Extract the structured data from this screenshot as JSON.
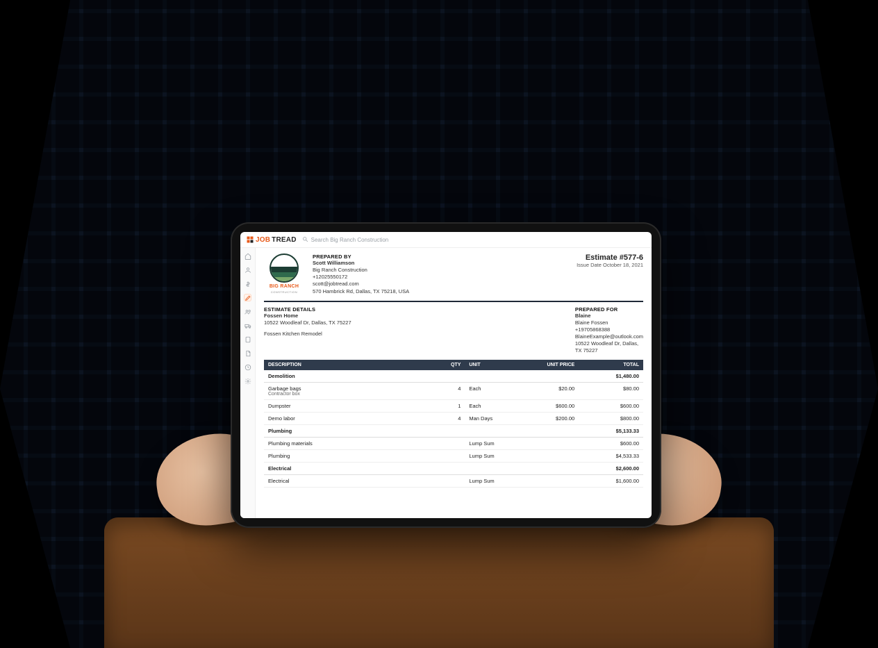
{
  "app": {
    "logo_job": "JOB",
    "logo_tread": "TREAD",
    "search_placeholder": "Search Big Ranch Construction"
  },
  "sidebar": {
    "items": [
      "home",
      "user",
      "dollar",
      "pencil",
      "people",
      "truck",
      "tablet",
      "document",
      "clock",
      "gear"
    ],
    "active_index": 3
  },
  "prepared_by": {
    "label": "PREPARED BY",
    "name": "Scott Williamson",
    "company": "Big Ranch Construction",
    "phone": "+12025550172",
    "email": "scott@jobtread.com",
    "address": "570 Hambrick Rd, Dallas, TX 75218, USA"
  },
  "company_logo": {
    "name": "BIG RANCH",
    "subtitle": "CONSTRUCTION"
  },
  "estimate": {
    "title": "Estimate #577-6",
    "issue_date": "Issue Date October 18, 2021"
  },
  "details": {
    "label": "ESTIMATE DETAILS",
    "project": "Fossen Home",
    "address": "10522 Woodleaf Dr, Dallas, TX 75227",
    "job": "Fossen Kitchen Remodel"
  },
  "prepared_for": {
    "label": "PREPARED FOR",
    "short_name": "Blaine",
    "full_name": "Blaine Fossen",
    "phone": "+19705868388",
    "email": "BlaineExample@outlook.com",
    "address1": "10522 Woodleaf Dr, Dallas,",
    "address2": "TX 75227"
  },
  "table": {
    "headers": {
      "description": "DESCRIPTION",
      "qty": "QTY",
      "unit": "UNIT",
      "unit_price": "UNIT PRICE",
      "total": "TOTAL"
    },
    "sections": [
      {
        "name": "Demolition",
        "total": "$1,480.00",
        "rows": [
          {
            "desc": "Garbage bags",
            "sub": "Contractor box",
            "qty": "4",
            "unit": "Each",
            "unit_price": "$20.00",
            "total": "$80.00"
          },
          {
            "desc": "Dumpster",
            "qty": "1",
            "unit": "Each",
            "unit_price": "$600.00",
            "total": "$600.00"
          },
          {
            "desc": "Demo labor",
            "qty": "4",
            "unit": "Man Days",
            "unit_price": "$200.00",
            "total": "$800.00"
          }
        ]
      },
      {
        "name": "Plumbing",
        "total": "$5,133.33",
        "rows": [
          {
            "desc": "Plumbing materials",
            "unit": "Lump Sum",
            "total": "$600.00"
          },
          {
            "desc": "Plumbing",
            "unit": "Lump Sum",
            "total": "$4,533.33"
          }
        ]
      },
      {
        "name": "Electrical",
        "total": "$2,600.00",
        "rows": [
          {
            "desc": "Electrical",
            "unit": "Lump Sum",
            "total": "$1,600.00"
          }
        ]
      }
    ]
  }
}
